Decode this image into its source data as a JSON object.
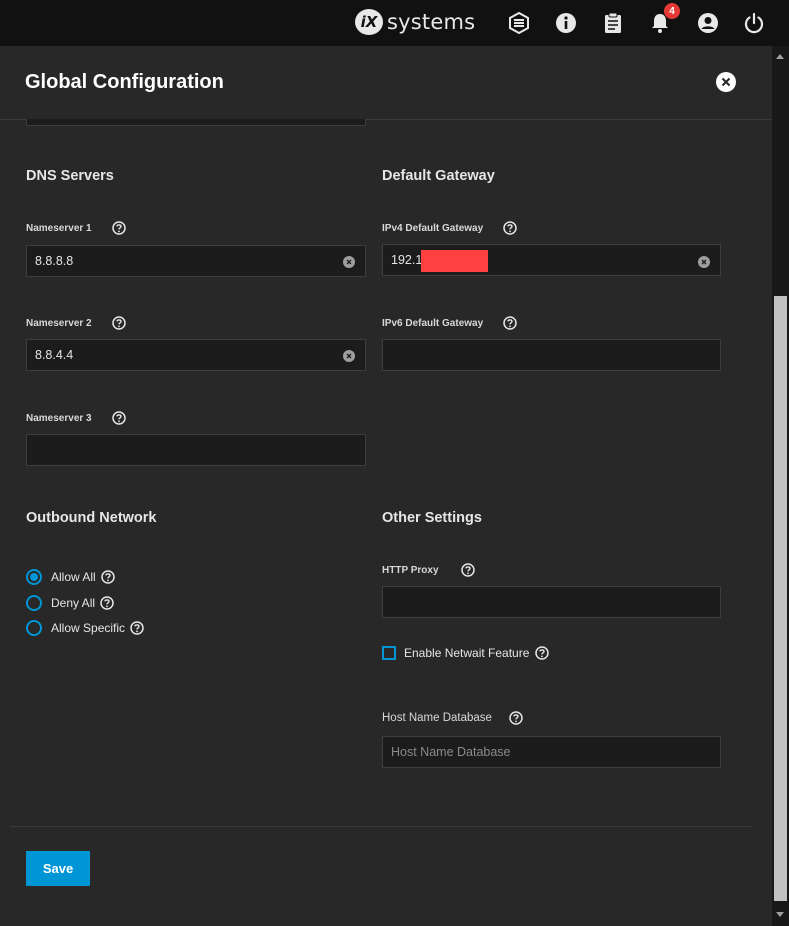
{
  "topbar": {
    "brand_mark": "iX",
    "brand_text": "systems",
    "notification_count": "4",
    "icons": [
      "truecommand-icon",
      "info-icon",
      "clipboard-icon",
      "bell-icon",
      "account-icon",
      "power-icon"
    ]
  },
  "dialog": {
    "title": "Global Configuration"
  },
  "dns": {
    "title": "DNS Servers",
    "ns1_label": "Nameserver 1",
    "ns1_value": "8.8.8.8",
    "ns2_label": "Nameserver 2",
    "ns2_value": "8.8.4.4",
    "ns3_label": "Nameserver 3",
    "ns3_value": ""
  },
  "gateway": {
    "title": "Default Gateway",
    "ipv4_label": "IPv4 Default Gateway",
    "ipv4_value": "192.1",
    "ipv6_label": "IPv6 Default Gateway",
    "ipv6_value": ""
  },
  "outbound": {
    "title": "Outbound Network",
    "options": [
      {
        "label": "Allow All",
        "selected": true
      },
      {
        "label": "Deny All",
        "selected": false
      },
      {
        "label": "Allow Specific",
        "selected": false
      }
    ]
  },
  "other": {
    "title": "Other Settings",
    "http_proxy_label": "HTTP Proxy",
    "http_proxy_value": "",
    "netwait_label": "Enable Netwait Feature",
    "netwait_checked": false,
    "hostdb_label": "Host Name Database",
    "hostdb_placeholder": "Host Name Database"
  },
  "actions": {
    "save_label": "Save"
  },
  "colors": {
    "accent": "#0095d5",
    "badge": "#e53935",
    "redaction": "#ff4040"
  }
}
